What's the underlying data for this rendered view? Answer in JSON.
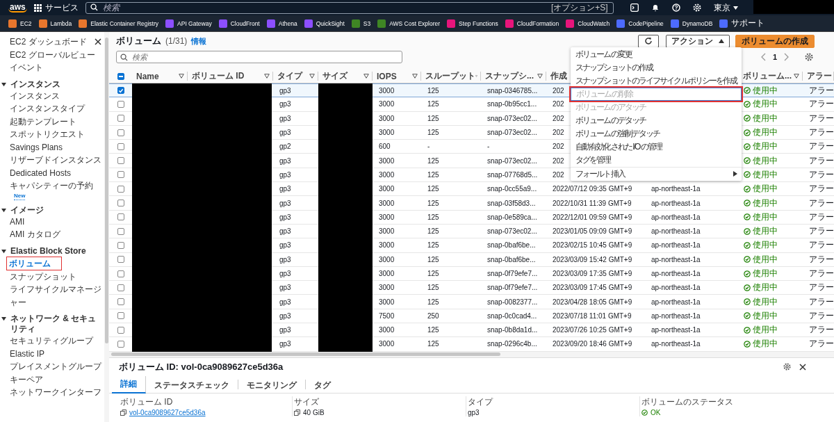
{
  "topnav": {
    "logo": "aws",
    "services": "サービス",
    "search": {
      "placeholder": "検索",
      "shortcut": "[オプション+S]"
    },
    "region": "東京"
  },
  "favorites": [
    {
      "label": "EC2",
      "color": "#e8762d"
    },
    {
      "label": "Lambda",
      "color": "#e8762d"
    },
    {
      "label": "Elastic Container Registry",
      "color": "#e8762d"
    },
    {
      "label": "API Gateway",
      "color": "#8c4fff"
    },
    {
      "label": "CloudFront",
      "color": "#8c4fff"
    },
    {
      "label": "Athena",
      "color": "#8c4fff"
    },
    {
      "label": "QuickSight",
      "color": "#8c4fff"
    },
    {
      "label": "S3",
      "color": "#3f8624"
    },
    {
      "label": "AWS Cost Explorer",
      "color": "#3f8624"
    },
    {
      "label": "Step Functions",
      "color": "#e7157b"
    },
    {
      "label": "CloudFormation",
      "color": "#e7157b"
    },
    {
      "label": "CloudWatch",
      "color": "#e7157b"
    },
    {
      "label": "CodePipeline",
      "color": "#4d6bfe"
    },
    {
      "label": "DynamoDB",
      "color": "#4d6bfe"
    },
    {
      "label": "サポート",
      "color": "#4d6bfe"
    }
  ],
  "sidebar": {
    "top_items": [
      {
        "label": "EC2 ダッシュボード",
        "selected": false,
        "highlighted": false
      },
      {
        "label": "EC2 グローバルビュー",
        "selected": false,
        "highlighted": false
      },
      {
        "label": "イベント",
        "selected": false,
        "highlighted": false
      }
    ],
    "sections": [
      {
        "title": "インスタンス",
        "expanded": true,
        "items": [
          {
            "label": "インスタンス",
            "selected": false,
            "highlighted": false
          },
          {
            "label": "インスタンスタイプ",
            "selected": false,
            "highlighted": false
          },
          {
            "label": "起動テンプレート",
            "selected": false,
            "highlighted": false
          },
          {
            "label": "スポットリクエスト",
            "selected": false,
            "highlighted": false
          },
          {
            "label": "Savings Plans",
            "selected": false,
            "highlighted": false
          },
          {
            "label": "リザーブドインスタンス",
            "selected": false,
            "highlighted": false
          },
          {
            "label": "Dedicated Hosts",
            "selected": false,
            "highlighted": false
          },
          {
            "label": "キャパシティーの予約",
            "selected": false,
            "highlighted": false,
            "badge": "New"
          }
        ]
      },
      {
        "title": "イメージ",
        "expanded": true,
        "items": [
          {
            "label": "AMI",
            "selected": false,
            "highlighted": false
          },
          {
            "label": "AMI カタログ",
            "selected": false,
            "highlighted": false
          }
        ]
      },
      {
        "title": "Elastic Block Store",
        "expanded": true,
        "items": [
          {
            "label": "ボリューム",
            "selected": true,
            "highlighted": true
          },
          {
            "label": "スナップショット",
            "selected": false,
            "highlighted": false
          },
          {
            "label": "ライフサイクルマネージャー",
            "selected": false,
            "highlighted": false
          }
        ]
      },
      {
        "title": "ネットワーク & セキュリティ",
        "expanded": true,
        "items": [
          {
            "label": "セキュリティグループ",
            "selected": false,
            "highlighted": false
          },
          {
            "label": "Elastic IP",
            "selected": false,
            "highlighted": false
          },
          {
            "label": "プレイスメントグループ",
            "selected": false,
            "highlighted": false
          },
          {
            "label": "キーペア",
            "selected": false,
            "highlighted": false
          },
          {
            "label": "ネットワークインターフ",
            "selected": false,
            "highlighted": false
          }
        ]
      }
    ]
  },
  "volumes": {
    "title": "ボリューム",
    "count": "(1/31)",
    "info": "情報",
    "search_placeholder": "検索",
    "actions_button": "アクション",
    "create_button": "ボリュームの作成",
    "page": "1",
    "header_indeterminate": true,
    "columns": [
      {
        "label": "Name",
        "sort_icon": true
      },
      {
        "label": "ボリューム ID",
        "sort_icon": true
      },
      {
        "label": "タイプ",
        "sort_icon": true
      },
      {
        "label": "サイズ",
        "sort_icon": true
      },
      {
        "label": "IOPS",
        "sort_icon": true
      },
      {
        "label": "スループット",
        "sort_icon": true
      },
      {
        "label": "スナップシ...",
        "sort_icon": true
      },
      {
        "label": "作成",
        "sort_icon": false
      },
      {
        "label": "ボリューム...",
        "sort_icon": true
      },
      {
        "label": "アラー",
        "sort_icon": false
      }
    ],
    "rows": [
      {
        "selected": true,
        "type": "gp3",
        "iops": "3000",
        "throughput": "125",
        "snapshot": "snap-0346785...",
        "created": "202",
        "status": "使用中",
        "alarm": "アラー"
      },
      {
        "selected": false,
        "type": "gp3",
        "iops": "3000",
        "throughput": "125",
        "snapshot": "snap-0b95cc1...",
        "created": "202",
        "status": "使用中",
        "alarm": "アラー"
      },
      {
        "selected": false,
        "type": "gp3",
        "iops": "3000",
        "throughput": "125",
        "snapshot": "snap-073ec02...",
        "created": "202",
        "status": "使用中",
        "alarm": "アラー"
      },
      {
        "selected": false,
        "type": "gp3",
        "iops": "3000",
        "throughput": "125",
        "snapshot": "snap-073ec02...",
        "created": "202",
        "status": "使用中",
        "alarm": "アラー"
      },
      {
        "selected": false,
        "type": "gp2",
        "iops": "600",
        "throughput": "-",
        "snapshot": "-",
        "created": "202",
        "status": "使用中",
        "alarm": "アラー"
      },
      {
        "selected": false,
        "type": "gp3",
        "iops": "3000",
        "throughput": "125",
        "snapshot": "snap-073ec02...",
        "created": "202",
        "status": "使用中",
        "alarm": "アラー"
      },
      {
        "selected": false,
        "type": "gp3",
        "iops": "3000",
        "throughput": "125",
        "snapshot": "snap-07768d5...",
        "created": "202",
        "status": "使用中",
        "alarm": "アラー"
      },
      {
        "selected": false,
        "type": "gp3",
        "iops": "3000",
        "throughput": "125",
        "snapshot": "snap-0cc55a9...",
        "created": "2022/07/12 09:35 GMT+9",
        "az": "ap-northeast-1a",
        "status": "使用中",
        "alarm": "アラー"
      },
      {
        "selected": false,
        "type": "gp3",
        "iops": "3000",
        "throughput": "125",
        "snapshot": "snap-03f58d3...",
        "created": "2022/10/31 11:39 GMT+9",
        "az": "ap-northeast-1a",
        "status": "使用中",
        "alarm": "アラー"
      },
      {
        "selected": false,
        "type": "gp3",
        "iops": "3000",
        "throughput": "125",
        "snapshot": "snap-0e589ca...",
        "created": "2022/12/01 09:59 GMT+9",
        "az": "ap-northeast-1a",
        "status": "使用中",
        "alarm": "アラー"
      },
      {
        "selected": false,
        "type": "gp3",
        "iops": "3000",
        "throughput": "125",
        "snapshot": "snap-073ec02...",
        "created": "2023/01/05 09:09 GMT+9",
        "az": "ap-northeast-1a",
        "status": "使用中",
        "alarm": "アラー"
      },
      {
        "selected": false,
        "type": "gp3",
        "iops": "3000",
        "throughput": "125",
        "snapshot": "snap-0baf6be...",
        "created": "2023/02/15 10:45 GMT+9",
        "az": "ap-northeast-1a",
        "status": "使用中",
        "alarm": "アラー"
      },
      {
        "selected": false,
        "type": "gp3",
        "iops": "3000",
        "throughput": "125",
        "snapshot": "snap-0baf6be...",
        "created": "2023/03/09 15:42 GMT+9",
        "az": "ap-northeast-1a",
        "status": "使用中",
        "alarm": "アラー"
      },
      {
        "selected": false,
        "type": "gp3",
        "iops": "3000",
        "throughput": "125",
        "snapshot": "snap-0f79efe7...",
        "created": "2023/03/09 17:35 GMT+9",
        "az": "ap-northeast-1a",
        "status": "使用中",
        "alarm": "アラー"
      },
      {
        "selected": false,
        "type": "gp3",
        "iops": "3000",
        "throughput": "125",
        "snapshot": "snap-0f79efe7...",
        "created": "2023/03/09 17:45 GMT+9",
        "az": "ap-northeast-1a",
        "status": "使用中",
        "alarm": "アラー"
      },
      {
        "selected": false,
        "type": "gp3",
        "iops": "3000",
        "throughput": "125",
        "snapshot": "snap-0082377...",
        "created": "2023/04/28 18:05 GMT+9",
        "az": "ap-northeast-1a",
        "status": "使用中",
        "alarm": "アラー"
      },
      {
        "selected": false,
        "type": "gp3",
        "iops": "7500",
        "throughput": "250",
        "snapshot": "snap-0c0cad4...",
        "created": "2023/07/18 11:01 GMT+9",
        "az": "ap-northeast-1a",
        "status": "使用中",
        "alarm": "アラー"
      },
      {
        "selected": false,
        "type": "gp3",
        "iops": "3000",
        "throughput": "125",
        "snapshot": "snap-0b8da1d...",
        "created": "2023/07/26 10:25 GMT+9",
        "az": "ap-northeast-1a",
        "status": "使用中",
        "alarm": "アラー"
      },
      {
        "selected": false,
        "type": "gp3",
        "iops": "3000",
        "throughput": "125",
        "snapshot": "snap-0296c4b...",
        "created": "2023/09/20 18:46 GMT+9",
        "az": "ap-northeast-1a",
        "status": "使用中",
        "alarm": "アラー"
      }
    ]
  },
  "action_menu": [
    {
      "label": "ボリュームの変更",
      "kind": "item",
      "disabled": false,
      "highlighted": false
    },
    {
      "label": "スナップショットの作成",
      "kind": "item",
      "disabled": false,
      "highlighted": false
    },
    {
      "label": "スナップショットのライフサイクルポリシーを作成",
      "kind": "item",
      "disabled": false,
      "highlighted": false
    },
    {
      "label": "ボリュームの削除",
      "kind": "item",
      "disabled": true,
      "highlighted": true
    },
    {
      "label": "ボリュームのアタッチ",
      "kind": "item",
      "disabled": true,
      "highlighted": false
    },
    {
      "label": "ボリュームのデタッチ",
      "kind": "item",
      "disabled": false,
      "highlighted": false
    },
    {
      "label": "ボリュームの強制デタッチ",
      "kind": "item",
      "disabled": false,
      "highlighted": false
    },
    {
      "label": "自動有効化された I/O の管理",
      "kind": "item",
      "disabled": false,
      "highlighted": false
    },
    {
      "label": "タグを管理",
      "kind": "item",
      "disabled": false,
      "highlighted": false
    },
    {
      "label": "フォールト挿入",
      "kind": "submenu",
      "disabled": false,
      "highlighted": false
    }
  ],
  "detail": {
    "title": "ボリューム ID: vol-0ca9089627ce5d36a",
    "tabs": [
      {
        "label": "詳細",
        "selected": true
      },
      {
        "label": "ステータスチェック",
        "selected": false
      },
      {
        "label": "モニタリング",
        "selected": false
      },
      {
        "label": "タグ",
        "selected": false
      }
    ],
    "fields": [
      {
        "label": "ボリューム ID",
        "value": "vol-0ca9089627ce5d36a",
        "kind": "copy-link"
      },
      {
        "label": "サイズ",
        "value": "40 GiB",
        "kind": "copy-text"
      },
      {
        "label": "タイプ",
        "value": "gp3",
        "kind": "text"
      },
      {
        "label": "ボリュームのステータス",
        "value": "OK",
        "kind": "status"
      }
    ]
  }
}
